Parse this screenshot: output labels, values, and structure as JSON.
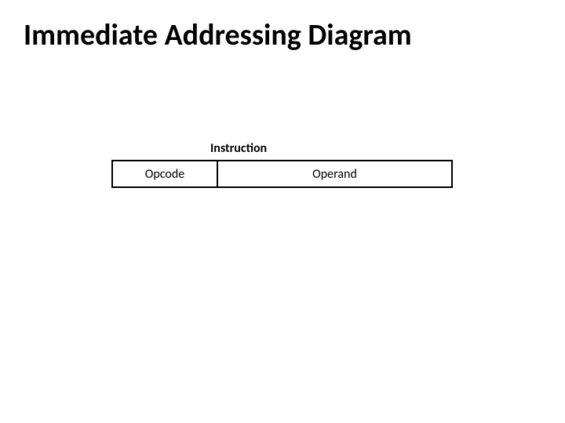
{
  "title": "Immediate Addressing Diagram",
  "diagram": {
    "instruction_label": "Instruction",
    "opcode": "Opcode",
    "operand": "Operand"
  }
}
